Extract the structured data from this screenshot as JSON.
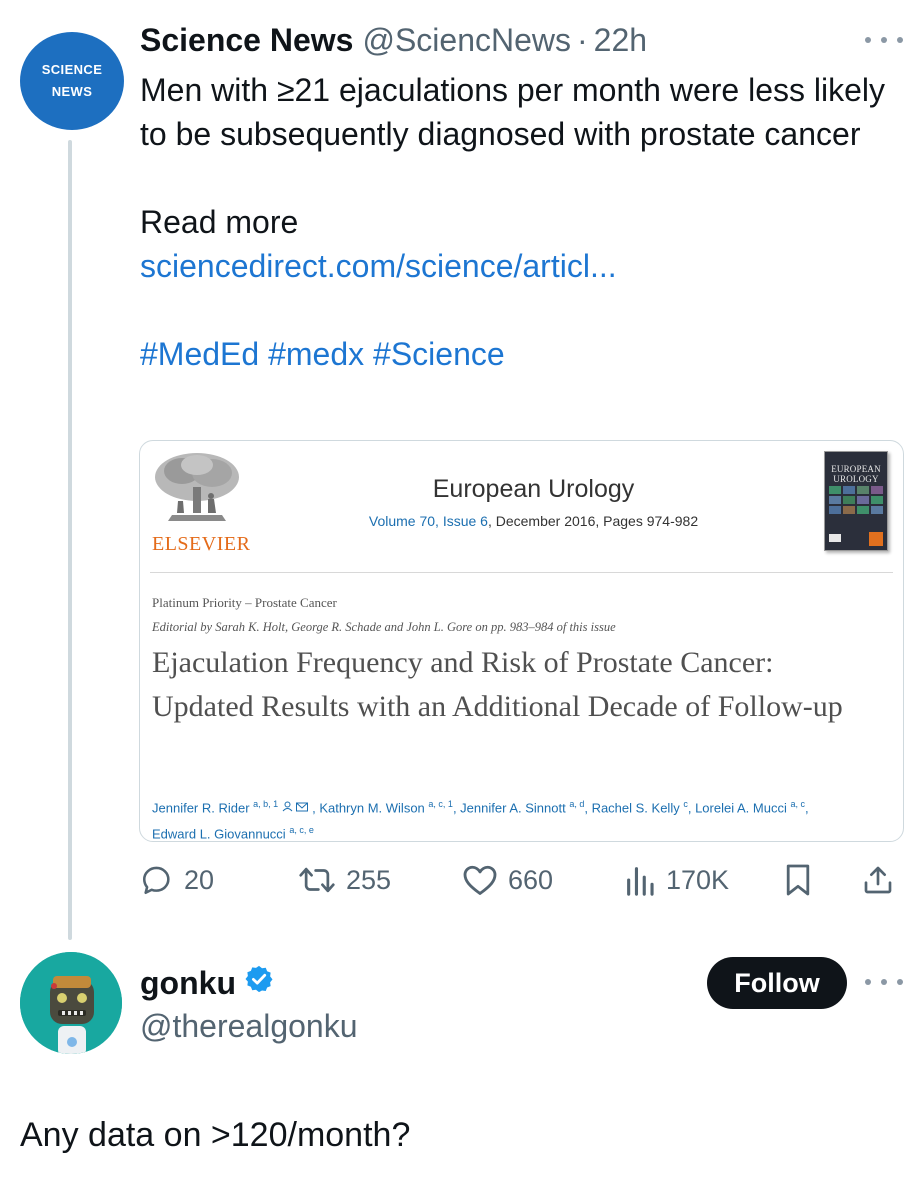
{
  "tweet1": {
    "avatar": {
      "line1": "SCIENCE",
      "line2": "NEWS",
      "color": "#1d6fc0"
    },
    "name": "Science News",
    "handle": "@SciencNews",
    "separator": "·",
    "time": "22h",
    "body": {
      "text": "Men with ≥21 ejaculations per month were less likely to be subsequently diagnosed with prostate cancer",
      "read_more": "Read more",
      "link": "sciencedirect.com/science/articl...",
      "hashtags": "#MedEd #medx #Science"
    },
    "card": {
      "publisher": "ELSEVIER",
      "journal": "European Urology",
      "volume_issue": "Volume 70, Issue 6",
      "date_pages": ", December 2016, Pages 974-982",
      "cover_title": "EUROPEAN UROLOGY",
      "category": "Platinum Priority – Prostate Cancer",
      "editorial": "Editorial by Sarah K. Holt, George R. Schade and John L. Gore on pp. 983–984 of this issue",
      "title": "Ejaculation Frequency and Risk of Prostate Cancer: Updated Results with an Additional Decade of Follow-up",
      "authors": [
        {
          "name": "Jennifer R. Rider",
          "sup": "a, b, 1"
        },
        {
          "name": "Kathryn M. Wilson",
          "sup": "a, c, 1"
        },
        {
          "name": "Jennifer A. Sinnott",
          "sup": "a, d"
        },
        {
          "name": "Rachel S. Kelly",
          "sup": "c"
        },
        {
          "name": "Lorelei A. Mucci",
          "sup": "a, c"
        },
        {
          "name": "Edward L. Giovannucci",
          "sup": "a, c, e"
        }
      ]
    },
    "actions": {
      "replies": "20",
      "retweets": "255",
      "likes": "660",
      "views": "170K"
    }
  },
  "tweet2": {
    "name": "gonku",
    "handle": "@therealgonku",
    "follow_label": "Follow",
    "body": "Any data on >120/month?",
    "avatar_color": "#18a8a0",
    "verified_color": "#1d9bf0"
  }
}
